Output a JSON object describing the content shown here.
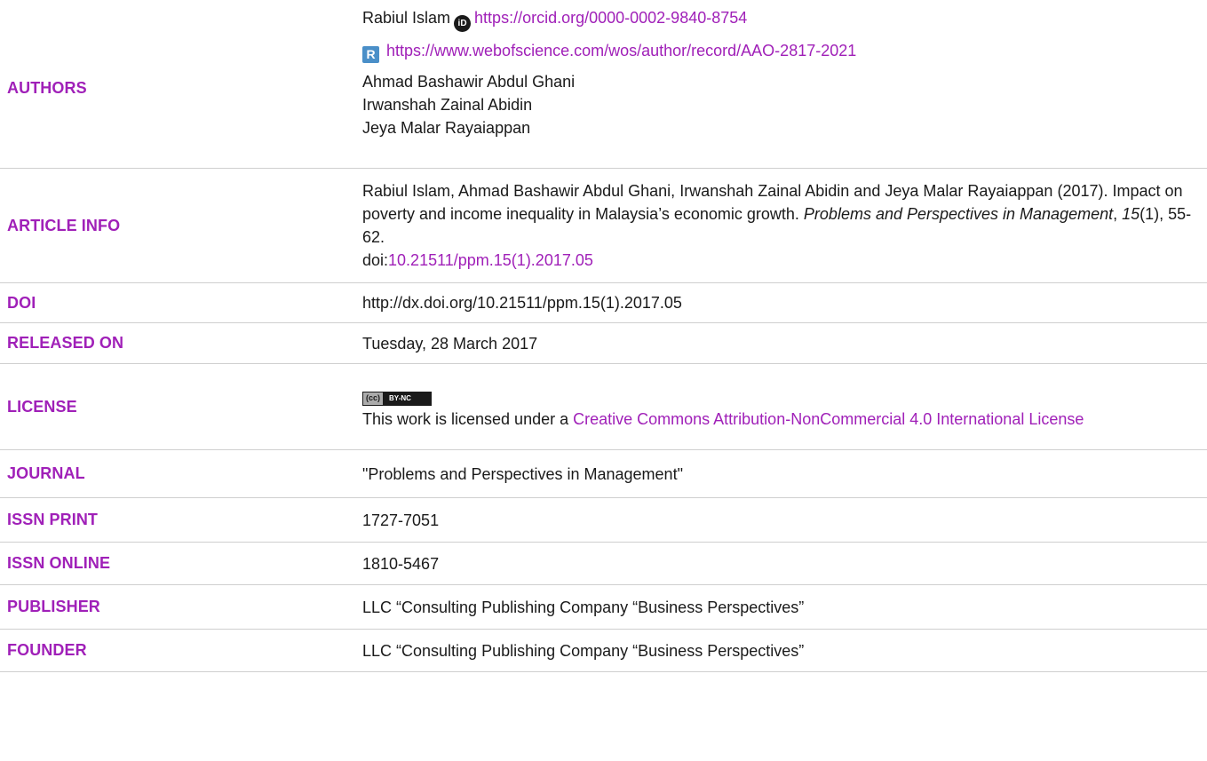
{
  "colors": {
    "label": "#a020b8",
    "link": "#a020b8",
    "text": "#1a1a1a",
    "divider": "#cfcfcf"
  },
  "authors": {
    "label": "AUTHORS",
    "author1_name": "Rabiul Islam",
    "orcid_icon_text": "iD",
    "orcid_url": "https://orcid.org/0000-0002-9840-8754",
    "researcherid_icon_text": "R",
    "wos_url": "https://www.webofscience.com/wos/author/record/AAO-2817-2021",
    "others": [
      "Ahmad Bashawir Abdul Ghani",
      "Irwanshah Zainal Abidin",
      "Jeya Malar Rayaiappan"
    ]
  },
  "article_info": {
    "label": "ARTICLE INFO",
    "citation_prefix": "Rabiul Islam, Ahmad Bashawir Abdul Ghani, Irwanshah Zainal Abidin and Jeya Malar Rayaiappan (2017). Impact on poverty and income inequality in Malaysia’s economic growth. ",
    "journal_italic": "Problems and Perspectives in Management",
    "sep1": ", ",
    "volume_italic": "15",
    "issue_pages": "(1), 55-62.",
    "doi_prefix": "doi:",
    "doi_link": "10.21511/ppm.15(1).2017.05"
  },
  "doi": {
    "label": "DOI",
    "value": "http://dx.doi.org/10.21511/ppm.15(1).2017.05"
  },
  "released_on": {
    "label": "RELEASED ON",
    "value": "Tuesday, 28 March 2017"
  },
  "license": {
    "label": "LICENSE",
    "badge_left": "(cc)",
    "badge_right": "BY-NC",
    "text_prefix": "This work is licensed under a ",
    "link_text": "Creative Commons Attribution-NonCommercial 4.0 International License"
  },
  "journal": {
    "label": "JOURNAL",
    "value": "\"Problems and Perspectives in Management\""
  },
  "issn_print": {
    "label": "ISSN PRINT",
    "value": "1727-7051"
  },
  "issn_online": {
    "label": "ISSN ONLINE",
    "value": "1810-5467"
  },
  "publisher": {
    "label": "PUBLISHER",
    "value": "LLC “Consulting Publishing Company “Business Perspectives”"
  },
  "founder": {
    "label": "FOUNDER",
    "value": "LLC “Consulting Publishing Company “Business Perspectives”"
  }
}
